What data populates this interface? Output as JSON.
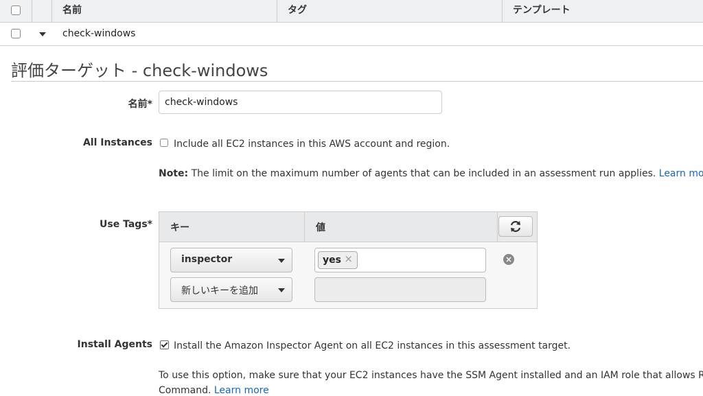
{
  "table": {
    "columns": [
      "名前",
      "タグ",
      "テンプレート"
    ],
    "rows": [
      {
        "name": "check-windows"
      }
    ]
  },
  "panel": {
    "title": "評価ターゲット - check-windows",
    "name_label": "名前*",
    "name_value": "check-windows",
    "all_instances": {
      "label": "All Instances",
      "checkbox_text": "Include all EC2 instances in this AWS account and region.",
      "checked": false,
      "note_bold": "Note:",
      "note_text": " The limit on the maximum number of agents that can be included in an assessment run applies. ",
      "note_link": "Learn more"
    },
    "use_tags": {
      "label": "Use Tags*",
      "col_key": "キー",
      "col_value": "値",
      "rows": [
        {
          "key": "inspector",
          "value_chip": "yes"
        },
        {
          "key": "新しいキーを追加",
          "value_chip": ""
        }
      ]
    },
    "install_agents": {
      "label": "Install Agents",
      "checkbox_text": "Install the Amazon Inspector Agent on all EC2 instances in this assessment target.",
      "checked": true,
      "info_text_1": "To use this option, make sure that your EC2 instances have the SSM Agent installed and an IAM role that allows Run",
      "info_text_2": "Command. ",
      "info_link": "Learn more"
    }
  },
  "icons": {
    "refresh": "refresh-icon",
    "remove": "remove-icon",
    "chip_close": "×"
  }
}
